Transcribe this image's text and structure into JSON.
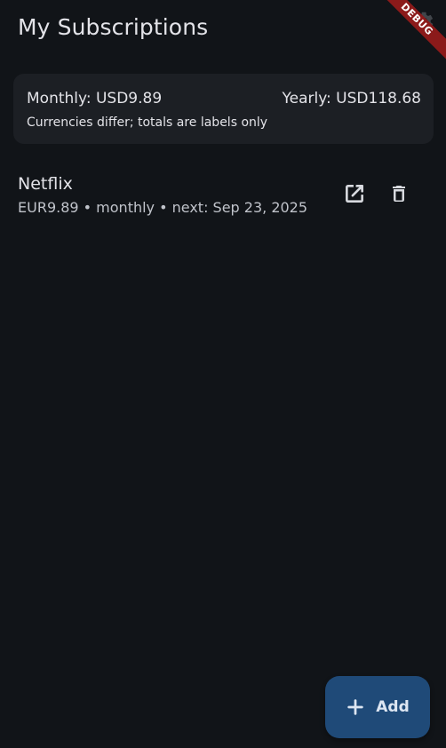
{
  "app_bar": {
    "title": "My Subscriptions",
    "debug_label": "DEBUG"
  },
  "totals": {
    "monthly": "Monthly: USD9.89",
    "yearly": "Yearly: USD118.68",
    "note": "Currencies differ; totals are labels only"
  },
  "subscriptions": [
    {
      "name": "Netflix",
      "details": "EUR9.89 • monthly • next: Sep 23, 2025",
      "icons": [
        "open-in-new-icon",
        "delete-icon"
      ]
    }
  ],
  "fab": {
    "label": "Add",
    "icon": "plus-icon"
  },
  "colors": {
    "background": "#111418",
    "card": "#1c1f24",
    "text": "#e3e3e8",
    "fab": "#1f4a78",
    "debug": "#8b1a1a"
  }
}
